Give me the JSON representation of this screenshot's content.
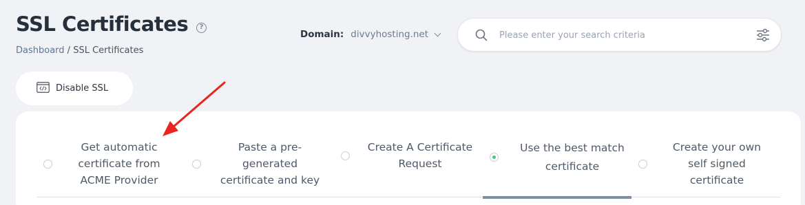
{
  "header": {
    "title": "SSL Certificates",
    "help_icon": "question-circle-icon",
    "breadcrumb": {
      "home": "Dashboard",
      "separator": " / ",
      "current": "SSL Certificates"
    }
  },
  "domain_selector": {
    "label": "Domain:",
    "value": "divvyhosting.net"
  },
  "search": {
    "placeholder": "Please enter your search criteria",
    "value": ""
  },
  "toolbar": {
    "disable_ssl_label": "Disable SSL"
  },
  "options": [
    {
      "line1": "Get automatic",
      "line2": "certificate from",
      "line3": "ACME Provider",
      "selected": false
    },
    {
      "line1": "Paste a pre-",
      "line2": "generated",
      "line3": "certificate and key",
      "selected": false
    },
    {
      "line1": "Create A Certificate",
      "line2": "Request",
      "line3": "",
      "selected": false
    },
    {
      "line1": "Use the best match",
      "line2": "certificate",
      "line3": "",
      "selected": true
    },
    {
      "line1": "Create your own",
      "line2": "self signed",
      "line3": "certificate",
      "selected": false
    }
  ],
  "colors": {
    "accent": "#7d8fa8",
    "selected_dot": "#4fc07e",
    "annotation_arrow": "#e8251e"
  }
}
